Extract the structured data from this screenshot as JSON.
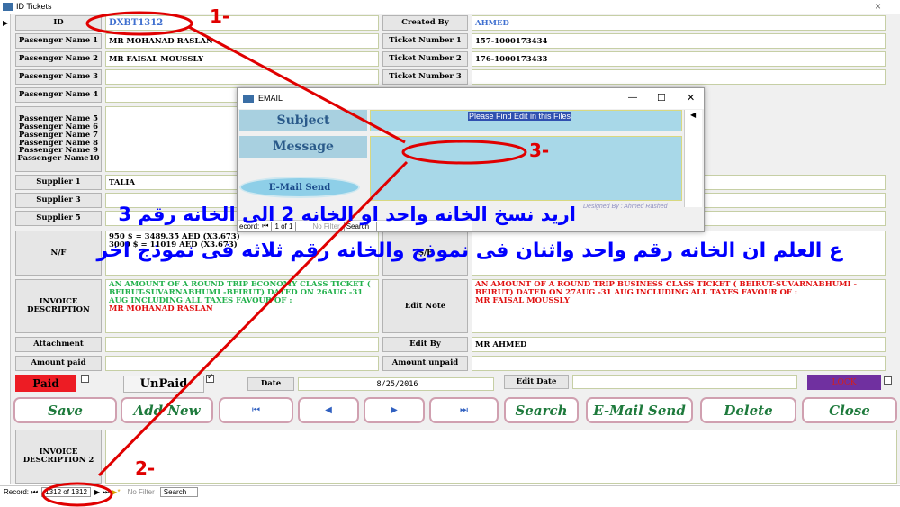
{
  "window": {
    "title": "ID Tickets",
    "close": "×"
  },
  "fields": {
    "id_label": "ID",
    "id_value": "DXBT1312",
    "created_by_label": "Created By",
    "created_by_value": "AHMED",
    "p1_label": "Passenger Name 1",
    "p1_value": "MR MOHANAD RASLAN",
    "t1_label": "Ticket Number 1",
    "t1_value": "157-1000173434",
    "p2_label": "Passenger Name 2",
    "p2_value": "MR FAISAL MOUSSLY",
    "t2_label": "Ticket Number 2",
    "t2_value": "176-1000173433",
    "p3_label": "Passenger Name 3",
    "t3_label": "Ticket Number 3",
    "p4_label": "Passenger Name 4",
    "p5_10_labels": [
      "Passenger Name 5",
      "Passenger Name 6",
      "Passenger Name 7",
      "Passenger Name 8",
      "Passenger Name 9",
      "Passenger Name10"
    ],
    "s1_label": "Supplier 1",
    "s1_value": "TALIA",
    "s3_label": "Supplier 3",
    "s5_label": "Supplier 5",
    "nf_label": "N/F",
    "nf_line1": "950  $ = 3489.35  AED   (X3.673)",
    "nf_line2": "3000 $ = 11019 AED      (X3.673)",
    "sf_label": "S/F",
    "invoice_desc_label": "INVOICE DESCRIPTION",
    "invoice_desc_value": "AN AMOUNT OF A ROUND TRIP ECONOMY CLASS TICKET ( BEIRUT-SUVARNABHUMI -BEIRUT) DATED ON 26AUG -31 AUG INCLUDING ALL TAXES FAVOUR OF :",
    "invoice_desc_name": "MR MOHANAD RASLAN",
    "edit_note_label": "Edit Note",
    "edit_note_value": "AN AMOUNT OF A ROUND TRIP BUSINESS CLASS  TICKET ( BEIRUT-SUVARNABHUMI -BEIRUT) DATED ON 27AUG -31 AUG INCLUDING ALL TAXES FAVOUR OF :",
    "edit_note_name": "MR FAISAL MOUSSLY",
    "attachment_label": "Attachment",
    "edit_by_label": "Edit By",
    "edit_by_value": "MR AHMED",
    "amount_paid_label": "Amount paid",
    "amount_unpaid_label": "Amount unpaid",
    "paid_label": "Paid",
    "unpaid_label": "UnPaid",
    "date_label": "Date",
    "date_value": "8/25/2016",
    "edit_date_label": "Edit Date",
    "lock_label": "LOCK",
    "invoice_desc2_label": "INVOICE DESCRIPTION 2"
  },
  "buttons": {
    "save": "Save",
    "add_new": "Add New",
    "first": "⏮",
    "prev": "◀",
    "next": "▶",
    "last": "⏭",
    "search": "Search",
    "email_send": "E-Mail Send",
    "delete": "Delete",
    "close": "Close"
  },
  "recordbar": {
    "record_label": "Record:",
    "record_value": "1312 of 1312",
    "no_filter": "No Filter",
    "search": "Search"
  },
  "dialog": {
    "title": "EMAIL",
    "subject_label": "Subject",
    "subject_value": "Please Find Edit in this Files",
    "message_label": "Message",
    "send_button": "E-Mail Send",
    "designed_by": "Designed By : Ahmed Rashed",
    "minimize": "—",
    "maximize": "☐",
    "close": "✕",
    "inner_record_label": "ecord:",
    "inner_record_value": "1 of 1",
    "inner_no_filter": "No Filter",
    "inner_search": "Search"
  },
  "annotations": {
    "n1": "1-",
    "n2": "2-",
    "n3": "3-",
    "arabic_line1": "اريد نسخ الخانه واحد او الخانه 2 الى الخانه رقم 3",
    "arabic_line2": "ع العلم ان الخانه رقم واحد واثنان فى نموذج والخانه رقم ثلاثه فى نموذج اخر"
  },
  "colors": {
    "accent_red": "#e00000",
    "paid_red": "#ed1c24",
    "lock_purple": "#7030a0",
    "button_green": "#1e7a3c",
    "annotation_blue": "#0000ff"
  }
}
